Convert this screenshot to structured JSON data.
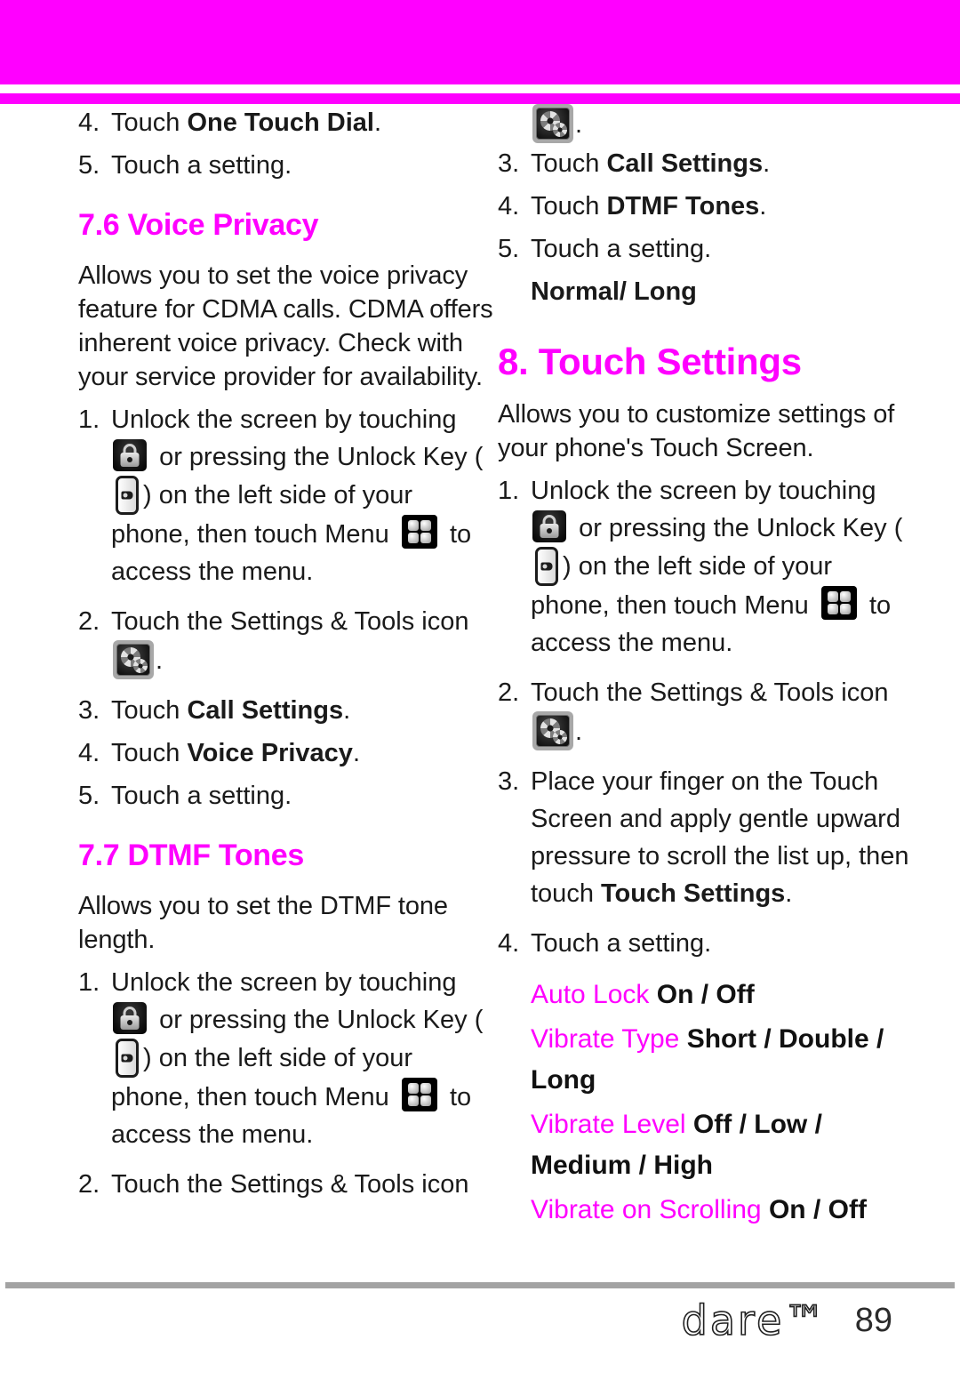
{
  "colors": {
    "accent": "#ff00ff",
    "text": "#1a1a1a",
    "rule": "#a3a3a3"
  },
  "header": {
    "band_color": "#ff00ff",
    "rule_color": "#ff00ff"
  },
  "left_column": {
    "steps_top": [
      {
        "num": "4.",
        "pre": "Touch ",
        "bold": "One Touch Dial",
        "post": "."
      },
      {
        "num": "5.",
        "pre": "Touch a setting.",
        "bold": "",
        "post": ""
      }
    ],
    "section_voice_privacy": {
      "heading": "7.6 Voice Privacy",
      "body": "Allows you to set the voice privacy feature for CDMA calls. CDMA offers inherent voice privacy. Check with your service provider for availability.",
      "steps": {
        "s1_a": "Unlock the screen by touching",
        "s1_b": "or pressing the Unlock Key",
        "s1_c": "(",
        "s1_d": ") on the left side of your phone, then touch Menu",
        "s1_e": "to access the menu.",
        "s1_num": "1.",
        "s2_num": "2.",
        "s2_text": "Touch the Settings & Tools icon",
        "s2_period": ".",
        "s3_num": "3.",
        "s3_pre": "Touch ",
        "s3_bold": "Call Settings",
        "s3_post": ".",
        "s4_num": "4.",
        "s4_pre": "Touch ",
        "s4_bold": "Voice Privacy",
        "s4_post": ".",
        "s5_num": "5.",
        "s5_text": "Touch a setting."
      }
    },
    "section_dtmf_tones": {
      "heading": "7.7 DTMF Tones",
      "body": "Allows you to set the DTMF tone length.",
      "steps": {
        "s1_num": "1.",
        "s1_a": "Unlock the screen by touching",
        "s1_b": "or pressing the Unlock Key",
        "s1_c": "(",
        "s1_d": ") on the left side of your phone, then touch Menu",
        "s1_e": "to access the menu.",
        "s2_num": "2.",
        "s2_text": "Touch the Settings & Tools icon"
      }
    }
  },
  "right_column": {
    "continued_dtmf": {
      "icon_period": ".",
      "s3_num": "3.",
      "s3_pre": "Touch ",
      "s3_bold": "Call Settings",
      "s3_post": ".",
      "s4_num": "4.",
      "s4_pre": "Touch ",
      "s4_bold": "DTMF Tones",
      "s4_post": ".",
      "s5_num": "5.",
      "s5_text": "Touch a setting.",
      "options": "Normal/ Long"
    },
    "section_touch_settings": {
      "heading": "8. Touch Settings",
      "body": "Allows you to customize settings of your phone's Touch Screen.",
      "steps": {
        "s1_num": "1.",
        "s1_a": "Unlock the screen by touching",
        "s1_b": "or pressing the Unlock Key",
        "s1_c": "(",
        "s1_d": ") on the left side of your phone, then touch Menu",
        "s1_e": "to access the menu.",
        "s2_num": "2.",
        "s2_text": "Touch the Settings & Tools icon",
        "s2_period": ".",
        "s3_num": "3.",
        "s3_pre": "Place your finger on the Touch Screen and apply gentle upward pressure to scroll the list up, then touch ",
        "s3_bold": "Touch Settings",
        "s3_post": ".",
        "s4_num": "4.",
        "s4_text": "Touch a setting."
      },
      "settings_list": [
        {
          "label": "Auto Lock",
          "values": "On / Off"
        },
        {
          "label": "Vibrate Type",
          "values": "Short / Double / Long"
        },
        {
          "label": "Vibrate Level",
          "values": "Off / Low / Medium / High"
        },
        {
          "label": "Vibrate on Scrolling",
          "values": "On / Off"
        }
      ]
    }
  },
  "footer": {
    "logo": "Dare",
    "trademark": "™",
    "page_number": "89"
  },
  "icons": {
    "lock": "padlock-icon",
    "key": "unlock-key-icon",
    "menu": "menu-grid-icon",
    "gear": "settings-tools-icon"
  }
}
